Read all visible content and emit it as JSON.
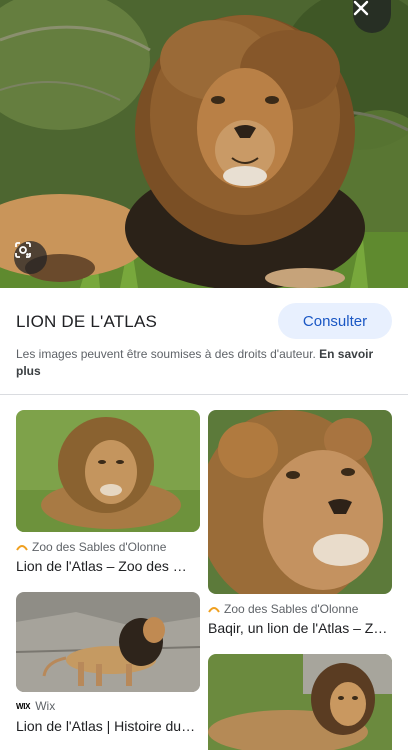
{
  "hero": {
    "close_icon": "close-icon",
    "lens_icon": "google-lens-icon"
  },
  "info": {
    "title": "LION DE L'ATLAS",
    "consult_label": "Consulter",
    "copyright_text": "Les images peuvent être soumises à des droits d'auteur.",
    "learn_more": "En savoir plus"
  },
  "results": [
    {
      "source": "Zoo des Sables d'Olonne",
      "favicon": "zoo-sables-favicon",
      "caption": "Lion de l'Atlas – Zoo des Sables d'Olonne"
    },
    {
      "source": "Wix",
      "favicon": "wix-favicon",
      "caption": "Lion de l'Atlas | Histoire du lion de l'Atlas"
    },
    {
      "source": "Zoo des Sables d'Olonne",
      "favicon": "zoo-sables-favicon",
      "caption": "Baqir, un lion de l'Atlas – Zoo des Sables"
    },
    {
      "source": "",
      "favicon": "",
      "caption": ""
    }
  ],
  "colors": {
    "accent_button_bg": "#e8f0fe",
    "accent_button_text": "#1a57c4",
    "lion_mane": "#7a4f25",
    "lion_dark_mane": "#2b2218"
  }
}
